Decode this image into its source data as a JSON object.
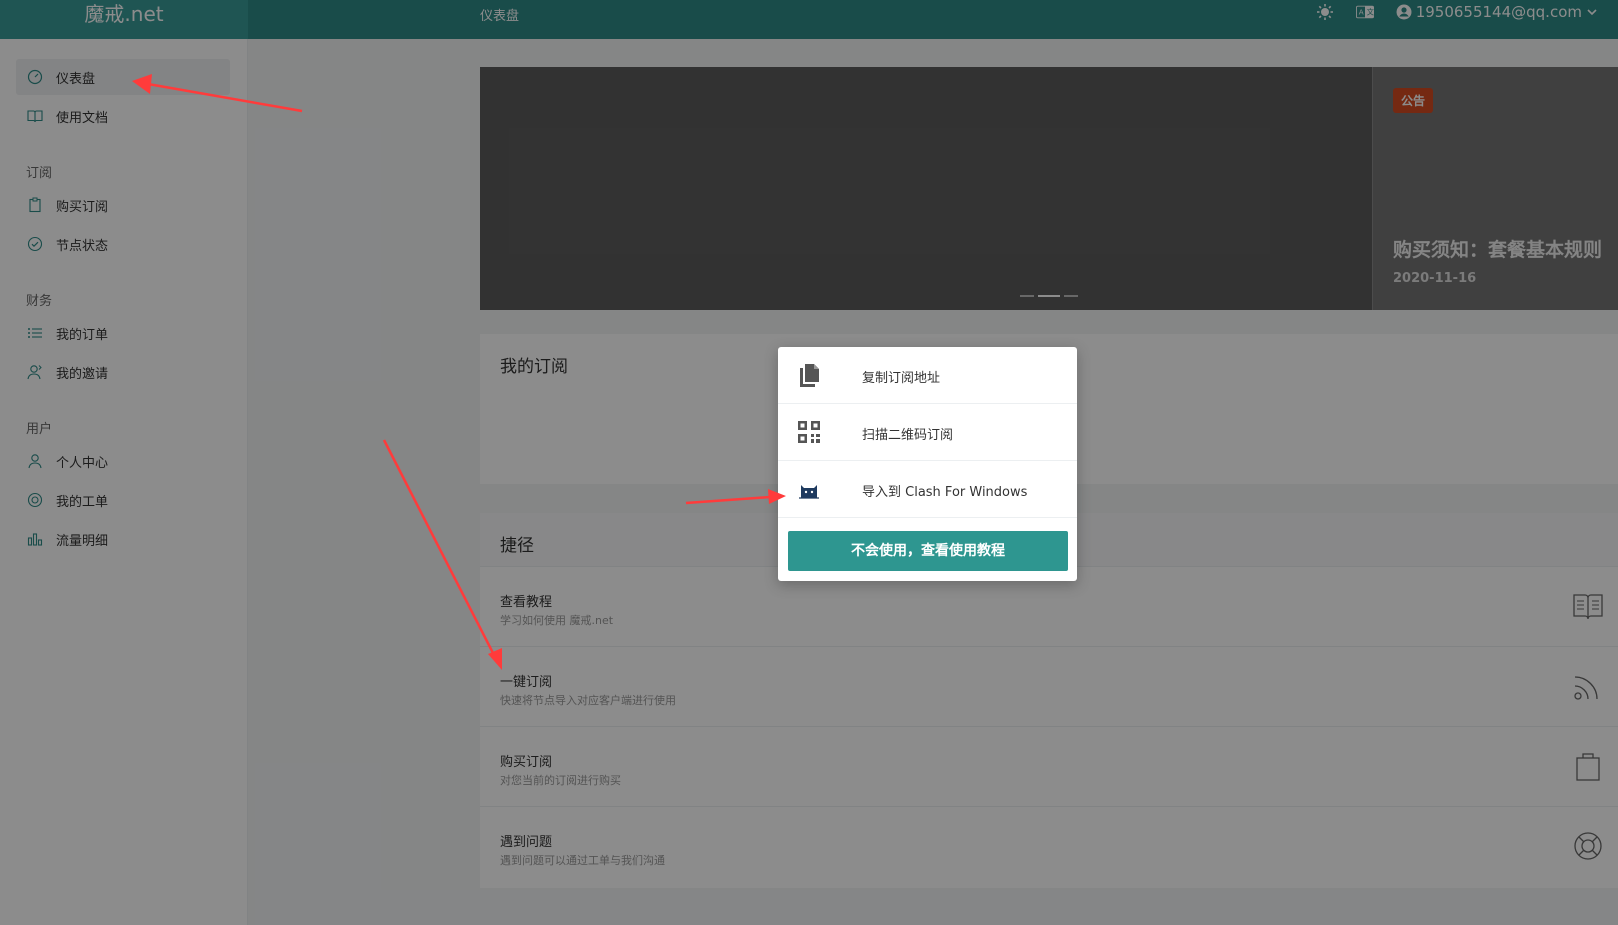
{
  "header": {
    "brand": "魔戒.net",
    "page_title": "仪表盘",
    "user_email": "1950655144@qq.com"
  },
  "sidebar": {
    "items": [
      {
        "label": "仪表盘",
        "icon": "dashboard-icon"
      },
      {
        "label": "使用文档",
        "icon": "book-icon"
      },
      {
        "label": "购买订阅",
        "icon": "clipboard-icon"
      },
      {
        "label": "节点状态",
        "icon": "check-circle-icon"
      },
      {
        "label": "我的订单",
        "icon": "list-icon"
      },
      {
        "label": "我的邀请",
        "icon": "invite-icon"
      },
      {
        "label": "个人中心",
        "icon": "user-icon"
      },
      {
        "label": "我的工单",
        "icon": "support-icon"
      },
      {
        "label": "流量明细",
        "icon": "bar-chart-icon"
      }
    ],
    "groups": {
      "subscribe": "订阅",
      "finance": "财务",
      "user": "用户"
    }
  },
  "notice": {
    "badge": "公告",
    "title": "购买须知：套餐基本规则",
    "date": "2020-11-16"
  },
  "subscription": {
    "title": "我的订阅"
  },
  "shortcuts": {
    "title": "捷径",
    "items": [
      {
        "title": "查看教程",
        "desc": "学习如何使用 魔戒.net",
        "icon": "book-open-icon"
      },
      {
        "title": "一键订阅",
        "desc": "快速将节点导入对应客户端进行使用",
        "icon": "rss-icon"
      },
      {
        "title": "购买订阅",
        "desc": "对您当前的订阅进行购买",
        "icon": "shopping-bag-icon"
      },
      {
        "title": "遇到问题",
        "desc": "遇到问题可以通过工单与我们沟通",
        "icon": "lifebuoy-icon"
      }
    ]
  },
  "modal": {
    "items": [
      {
        "label": "复制订阅地址",
        "icon": "copy-icon"
      },
      {
        "label": "扫描二维码订阅",
        "icon": "qrcode-icon"
      },
      {
        "label": "导入到 Clash For Windows",
        "icon": "clash-cat-icon"
      }
    ],
    "button": "不会使用，查看使用教程"
  },
  "colors": {
    "primary": "#2e8a87",
    "button": "#2e9690",
    "badge": "#d54b22",
    "arrow": "#ff3b3b"
  }
}
